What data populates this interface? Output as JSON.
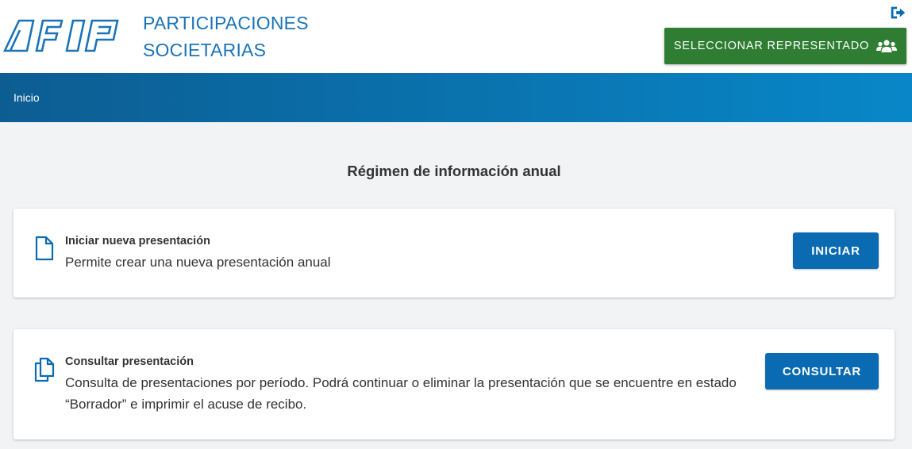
{
  "header": {
    "logo_text": "AFIP",
    "app_title_line1": "PARTICIPACIONES",
    "app_title_line2": "SOCIETARIAS",
    "select_button_label": "SELECCIONAR REPRESENTADO",
    "logout_icon": "sign-out-icon",
    "select_button_icon": "users-icon",
    "brand_color": "#1a73b8",
    "select_button_color": "#2e7d32"
  },
  "breadcrumb": {
    "home_label": "Inicio"
  },
  "main": {
    "section_title": "Régimen de información anual",
    "cards": [
      {
        "icon": "file-icon",
        "title": "Iniciar nueva presentación",
        "description": "Permite crear una nueva presentación anual",
        "button_label": "INICIAR"
      },
      {
        "icon": "copy-icon",
        "title": "Consultar presentación",
        "description": "Consulta de presentaciones por período. Podrá continuar o eliminar la presentación que se encuentre en estado “Borrador” e imprimir el acuse de recibo.",
        "button_label": "CONSULTAR"
      }
    ],
    "button_color": "#0a6bb3"
  }
}
